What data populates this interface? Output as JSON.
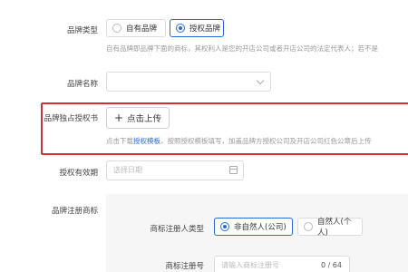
{
  "form": {
    "brand_type": {
      "label": "品牌类型",
      "options": [
        {
          "label": "自有品牌",
          "selected": false
        },
        {
          "label": "授权品牌",
          "selected": true
        }
      ],
      "hint": "自有品牌即品牌下面的商标，其权利人是您的开店公司或者开店公司的法定代表人；若不是"
    },
    "brand_name": {
      "label": "品牌名称",
      "value": ""
    },
    "authorization": {
      "label": "品牌独占授权书",
      "upload_label": "点击上传",
      "hint_prefix": "点击下载",
      "hint_link": "授权模板",
      "hint_suffix": "，按照授权模板填写，加盖品牌方授权公司及开店公司红色公章后上传"
    },
    "valid_period": {
      "label": "授权有效期",
      "placeholder": "选择日期"
    },
    "trademark": {
      "label": "品牌注册商标",
      "registrant_type": {
        "label": "商标注册人类型",
        "options": [
          {
            "label": "非自然人(公司)",
            "selected": true
          },
          {
            "label": "自然人(个人)",
            "selected": false
          }
        ]
      },
      "registration_no": {
        "label": "商标注册号",
        "placeholder": "请输入商标注册号",
        "counter": "0 / 64"
      }
    }
  },
  "colors": {
    "accent": "#2b6bd6",
    "highlight_box": "#c8352c"
  }
}
